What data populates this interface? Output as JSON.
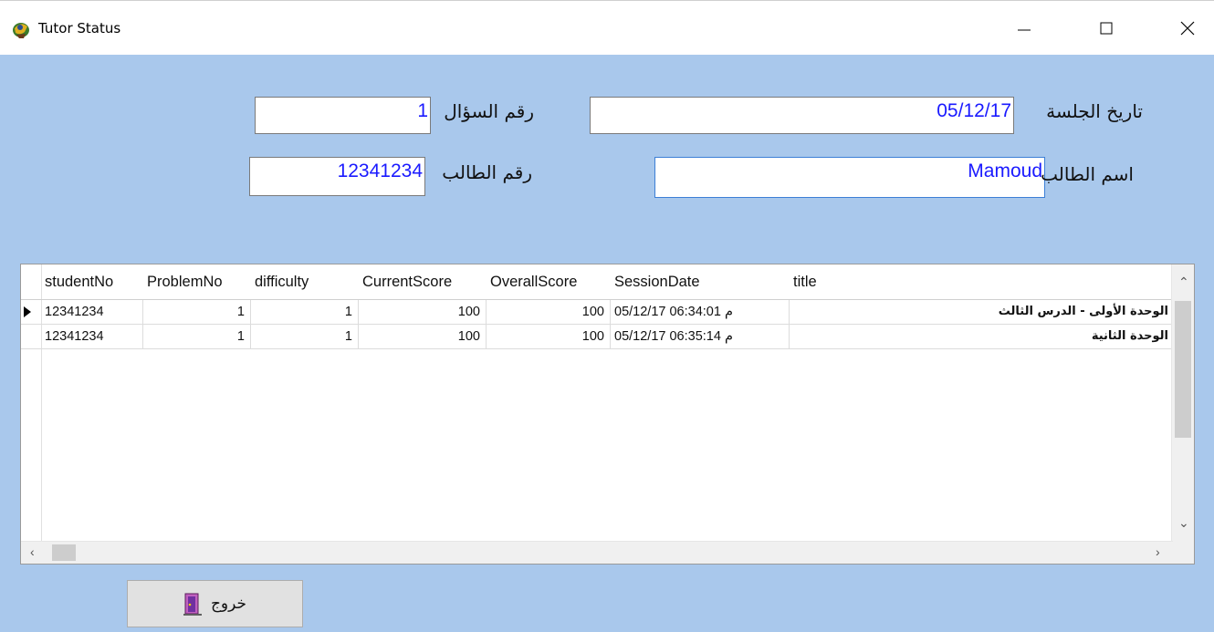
{
  "window": {
    "title": "Tutor Status",
    "icon": "tutor-app-icon",
    "controls": [
      "minimize-icon",
      "maximize-icon",
      "close-icon"
    ]
  },
  "form": {
    "session_date_label": "تاريخ الجلسة",
    "session_date_value": "05/12/17",
    "question_no_label": "رقم السؤال",
    "question_no_value": "1",
    "student_name_label": "اسم الطالب",
    "student_name_value": "Mamoud",
    "student_no_label": "رقم الطالب",
    "student_no_value": "12341234"
  },
  "grid": {
    "columns": [
      "studentNo",
      "ProblemNo",
      "difficulty",
      "CurrentScore",
      "OverallScore",
      "SessionDate",
      "title"
    ],
    "rows": [
      {
        "studentNo": "12341234",
        "ProblemNo": "1",
        "difficulty": "1",
        "CurrentScore": "100",
        "OverallScore": "100",
        "SessionDate": "05/12/17 06:34:01 م",
        "title": "الوحدة الأولى - الدرس الثالث"
      },
      {
        "studentNo": "12341234",
        "ProblemNo": "1",
        "difficulty": "1",
        "CurrentScore": "100",
        "OverallScore": "100",
        "SessionDate": "05/12/17 06:35:14 م",
        "title": "الوحدة الثانية"
      }
    ]
  },
  "exit_button": {
    "label": "خروج",
    "icon": "exit-door-icon"
  },
  "colors": {
    "background": "#a9c8ec",
    "field_text": "#1a1aff"
  }
}
